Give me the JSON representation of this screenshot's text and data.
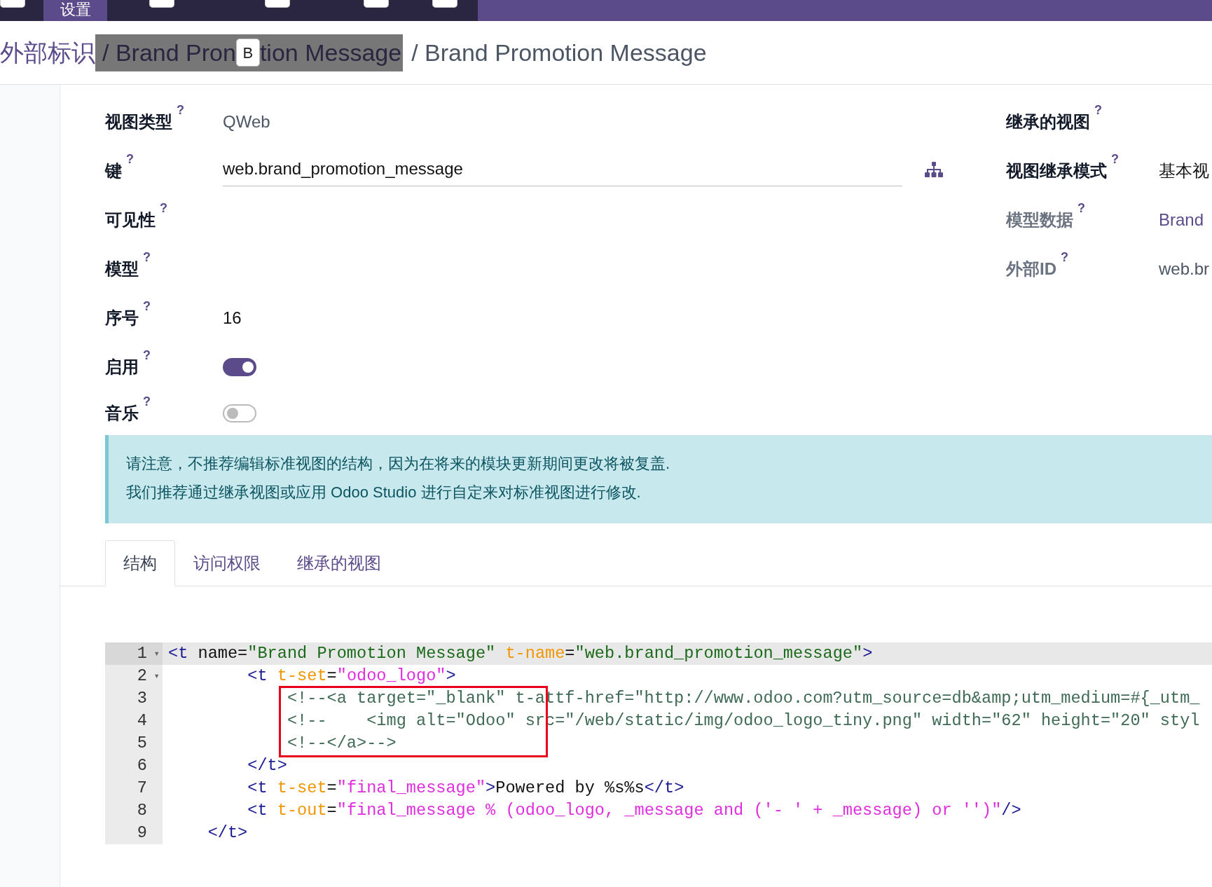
{
  "top_bar": {
    "items": [
      {
        "kind": "badge"
      },
      {
        "kind": "menu",
        "text": "设置",
        "selected": true
      },
      {
        "kind": "badge"
      },
      {
        "kind": "badge"
      },
      {
        "kind": "badge"
      },
      {
        "kind": "badge"
      }
    ]
  },
  "breadcrumb": [
    {
      "kind": "link",
      "text": "外部标识"
    },
    {
      "kind": "highlighted",
      "text": "/ Brand Pron"
    },
    {
      "kind": "hotkey",
      "text": "B"
    },
    {
      "kind": "highlighted",
      "text": "tion Message"
    },
    {
      "kind": "current",
      "text": "/ Brand Promotion Message"
    }
  ],
  "form": {
    "left": [
      {
        "label": "视图类型",
        "help": "?",
        "kind": "text",
        "value": "QWeb",
        "muted": true
      },
      {
        "label": "键",
        "help": "?",
        "kind": "input",
        "value": "web.brand_promotion_message"
      },
      {
        "label": "可见性",
        "help": "?",
        "kind": "empty"
      },
      {
        "label": "模型",
        "help": "?",
        "kind": "empty"
      },
      {
        "label": "序号",
        "help": "?",
        "kind": "text",
        "value": "16",
        "muted": false
      },
      {
        "label": "启用",
        "help": "?",
        "kind": "toggle",
        "on": true
      },
      {
        "label": "音乐",
        "help": "?",
        "kind": "toggle",
        "on": false
      }
    ],
    "right": [
      {
        "label": "继承的视图",
        "help": "?",
        "muted": false,
        "kind": "empty"
      },
      {
        "label": "视图继承模式",
        "help": "?",
        "muted": false,
        "kind": "text",
        "value": "基本视"
      },
      {
        "label": "模型数据",
        "help": "?",
        "muted": true,
        "kind": "link",
        "value": "Brand"
      },
      {
        "label": "外部ID",
        "help": "?",
        "muted": true,
        "kind": "text",
        "value": "web.br"
      }
    ]
  },
  "alert": [
    "请注意，不推荐编辑标准视图的结构，因为在将来的模块更新期间更改将被复盖.",
    "我们推荐通过继承视图或应用 Odoo Studio 进行自定来对标准视图进行修改."
  ],
  "tabs": [
    {
      "label": "结构",
      "selected": true
    },
    {
      "label": "访问权限",
      "selected": false
    },
    {
      "label": "继承的视图",
      "selected": false
    }
  ],
  "code": [
    {
      "number": "1",
      "fold": "▾",
      "active": true,
      "boxed": false,
      "tokens": [
        {
          "kind": "tag",
          "text": "<t"
        },
        {
          "kind": "plain",
          "text": " name="
        },
        {
          "kind": "string",
          "text": "\"Brand Promotion Message\" "
        },
        {
          "kind": "tattr",
          "text": "t-name"
        },
        {
          "kind": "plain",
          "text": "="
        },
        {
          "kind": "string",
          "text": "\"web.brand_promotion_message\""
        },
        {
          "kind": "tag",
          "text": ">"
        }
      ]
    },
    {
      "number": "2",
      "fold": "▾",
      "active": false,
      "boxed": false,
      "tokens": [
        {
          "kind": "tag",
          "text": "        <t "
        },
        {
          "kind": "tattr",
          "text": "t-set"
        },
        {
          "kind": "plain",
          "text": "="
        },
        {
          "kind": "tstring",
          "text": "\"odoo_logo\""
        },
        {
          "kind": "tag",
          "text": ">"
        }
      ]
    },
    {
      "number": "3",
      "active": false,
      "boxed": true,
      "tokens": [
        {
          "kind": "comment",
          "text": "            <!--<a target=\"_blank\" t-attf-href=\"http://www.odoo.com?utm_source=db&amp;utm_medium=#{_utm_"
        }
      ]
    },
    {
      "number": "4",
      "active": false,
      "boxed": true,
      "tokens": [
        {
          "kind": "comment",
          "text": "            <!--    <img alt=\"Odoo\" src=\"/web/static/img/odoo_logo_tiny.png\" width=\"62\" height=\"20\" styl"
        }
      ]
    },
    {
      "number": "5",
      "active": false,
      "boxed": true,
      "tokens": [
        {
          "kind": "comment",
          "text": "            <!--</a>-->"
        }
      ]
    },
    {
      "number": "6",
      "active": false,
      "boxed": false,
      "tokens": [
        {
          "kind": "tag",
          "text": "        </t>"
        }
      ]
    },
    {
      "number": "7",
      "active": false,
      "boxed": false,
      "tokens": [
        {
          "kind": "tag",
          "text": "        <t "
        },
        {
          "kind": "tattr",
          "text": "t-set"
        },
        {
          "kind": "plain",
          "text": "="
        },
        {
          "kind": "tstring",
          "text": "\"final_message\""
        },
        {
          "kind": "tag",
          "text": ">"
        },
        {
          "kind": "plain",
          "text": "Powered by %s%s"
        },
        {
          "kind": "tag",
          "text": "</t>"
        }
      ]
    },
    {
      "number": "8",
      "active": false,
      "boxed": false,
      "tokens": [
        {
          "kind": "tag",
          "text": "        <t "
        },
        {
          "kind": "tattr",
          "text": "t-out"
        },
        {
          "kind": "plain",
          "text": "="
        },
        {
          "kind": "tstring",
          "text": "\"final_message % (odoo_logo, _message and ('- ' + _message) or '')\""
        },
        {
          "kind": "tag",
          "text": "/>"
        }
      ]
    },
    {
      "number": "9",
      "active": false,
      "boxed": false,
      "tokens": [
        {
          "kind": "tag",
          "text": "    </t>"
        }
      ]
    }
  ]
}
